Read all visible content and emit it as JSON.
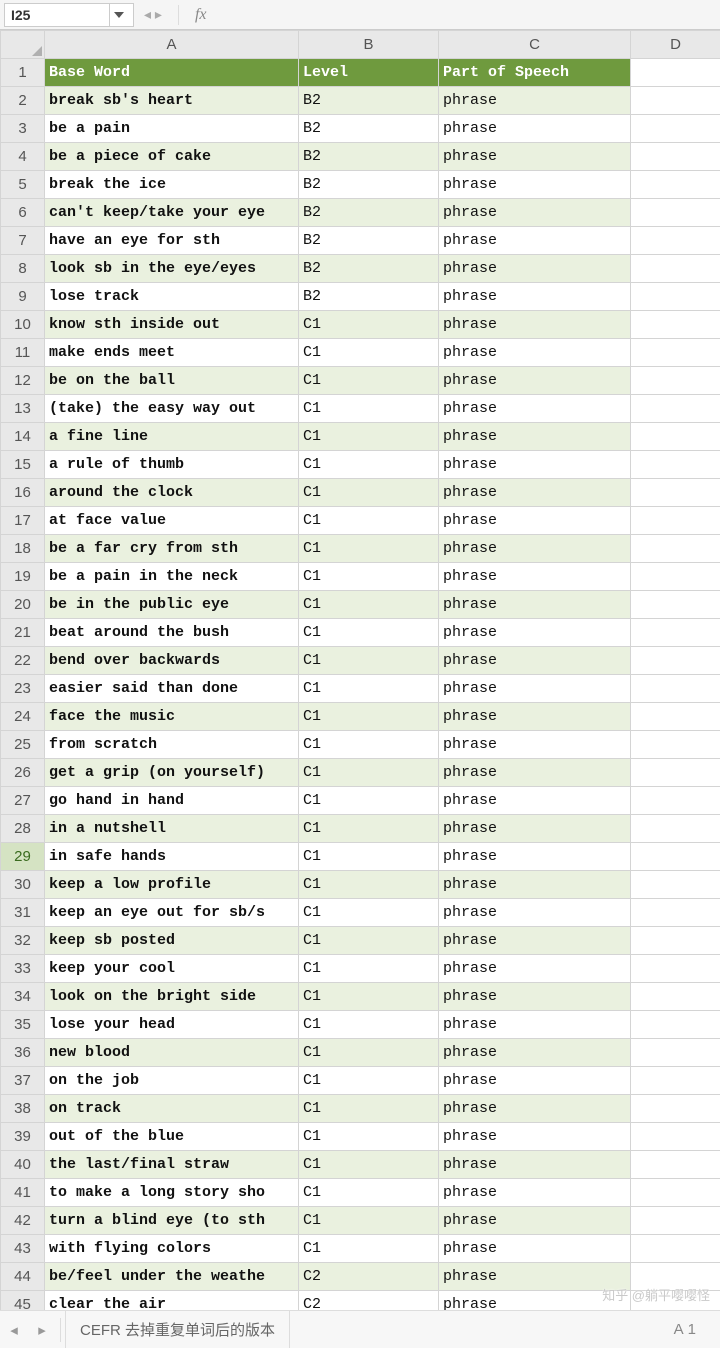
{
  "toolbar": {
    "namebox_value": "I25",
    "fx_label": "fx"
  },
  "columns": [
    "A",
    "B",
    "C",
    "D"
  ],
  "header_row": {
    "base_word": "Base Word",
    "level": "Level",
    "part_of_speech": "Part of Speech"
  },
  "active_row": 29,
  "chart_data": {
    "type": "table",
    "columns": [
      "Base Word",
      "Level",
      "Part of Speech"
    ],
    "rows": [
      {
        "base": "break sb's heart",
        "level": "B2",
        "pos": "phrase"
      },
      {
        "base": "be a pain",
        "level": "B2",
        "pos": "phrase"
      },
      {
        "base": "be a piece of cake",
        "level": "B2",
        "pos": "phrase"
      },
      {
        "base": "break the ice",
        "level": "B2",
        "pos": "phrase"
      },
      {
        "base": "can't keep/take your eye",
        "level": "B2",
        "pos": "phrase"
      },
      {
        "base": "have an eye for sth",
        "level": "B2",
        "pos": "phrase"
      },
      {
        "base": "look sb in the eye/eyes",
        "level": "B2",
        "pos": "phrase"
      },
      {
        "base": "lose track",
        "level": "B2",
        "pos": "phrase"
      },
      {
        "base": "know sth inside out",
        "level": "C1",
        "pos": "phrase"
      },
      {
        "base": "make ends meet",
        "level": "C1",
        "pos": "phrase"
      },
      {
        "base": "be on the ball",
        "level": "C1",
        "pos": "phrase"
      },
      {
        "base": "(take) the easy way out",
        "level": "C1",
        "pos": "phrase"
      },
      {
        "base": "a fine line",
        "level": "C1",
        "pos": "phrase"
      },
      {
        "base": "a rule of thumb",
        "level": "C1",
        "pos": "phrase"
      },
      {
        "base": "around the clock",
        "level": "C1",
        "pos": "phrase"
      },
      {
        "base": "at face value",
        "level": "C1",
        "pos": "phrase"
      },
      {
        "base": "be a far cry from sth",
        "level": "C1",
        "pos": "phrase"
      },
      {
        "base": "be a pain in the neck",
        "level": "C1",
        "pos": "phrase"
      },
      {
        "base": "be in the public eye",
        "level": "C1",
        "pos": "phrase"
      },
      {
        "base": "beat around the bush",
        "level": "C1",
        "pos": "phrase"
      },
      {
        "base": "bend over backwards",
        "level": "C1",
        "pos": "phrase"
      },
      {
        "base": "easier said than done",
        "level": "C1",
        "pos": "phrase"
      },
      {
        "base": "face the music",
        "level": "C1",
        "pos": "phrase"
      },
      {
        "base": "from scratch",
        "level": "C1",
        "pos": "phrase"
      },
      {
        "base": "get a grip (on yourself)",
        "level": "C1",
        "pos": "phrase"
      },
      {
        "base": "go hand in hand",
        "level": "C1",
        "pos": "phrase"
      },
      {
        "base": "in a nutshell",
        "level": "C1",
        "pos": "phrase"
      },
      {
        "base": "in safe hands",
        "level": "C1",
        "pos": "phrase"
      },
      {
        "base": "keep a low profile",
        "level": "C1",
        "pos": "phrase"
      },
      {
        "base": "keep an eye out for sb/s",
        "level": "C1",
        "pos": "phrase"
      },
      {
        "base": "keep sb posted",
        "level": "C1",
        "pos": "phrase"
      },
      {
        "base": "keep your cool",
        "level": "C1",
        "pos": "phrase"
      },
      {
        "base": "look on the bright side",
        "level": "C1",
        "pos": "phrase"
      },
      {
        "base": "lose your head",
        "level": "C1",
        "pos": "phrase"
      },
      {
        "base": "new blood",
        "level": "C1",
        "pos": "phrase"
      },
      {
        "base": "on the job",
        "level": "C1",
        "pos": "phrase"
      },
      {
        "base": "on track",
        "level": "C1",
        "pos": "phrase"
      },
      {
        "base": "out of the blue",
        "level": "C1",
        "pos": "phrase"
      },
      {
        "base": "the last/final straw",
        "level": "C1",
        "pos": "phrase"
      },
      {
        "base": "to make a long story sho",
        "level": "C1",
        "pos": "phrase"
      },
      {
        "base": "turn a blind eye (to sth",
        "level": "C1",
        "pos": "phrase"
      },
      {
        "base": "with flying colors",
        "level": "C1",
        "pos": "phrase"
      },
      {
        "base": "be/feel under the weathe",
        "level": "C2",
        "pos": "phrase"
      },
      {
        "base": "clear the air",
        "level": "C2",
        "pos": "phrase"
      }
    ]
  },
  "bottombar": {
    "sheet_tab": "CEFR 去掉重复单词后的版本",
    "cell_ref": "A1"
  },
  "watermark": "知乎 @躺平嘤嘤怪"
}
